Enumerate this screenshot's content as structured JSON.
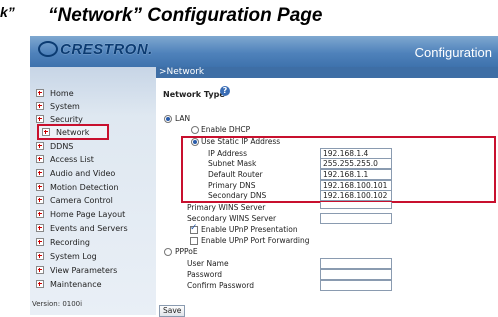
{
  "doc": {
    "title_fragment": "k”",
    "title": "“Network” Configuration Page"
  },
  "header": {
    "logo_text": "CRESTRON.",
    "right_text": "Configuration",
    "colors": {
      "gradient_top": "#7fa8d0",
      "gradient_bottom": "#3e72ad",
      "logo": "#0b3b72"
    }
  },
  "breadcrumb": ">Network",
  "sidebar": {
    "items": [
      {
        "label": "Home"
      },
      {
        "label": "System"
      },
      {
        "label": "Security"
      },
      {
        "label": "Network",
        "active": true
      },
      {
        "label": "DDNS"
      },
      {
        "label": "Access List"
      },
      {
        "label": "Audio and Video"
      },
      {
        "label": "Motion Detection"
      },
      {
        "label": "Camera Control"
      },
      {
        "label": "Home Page Layout"
      },
      {
        "label": "Events and Servers"
      },
      {
        "label": "Recording"
      },
      {
        "label": "System Log"
      },
      {
        "label": "View Parameters"
      },
      {
        "label": "Maintenance"
      }
    ],
    "version": "Version: 0100i",
    "highlight_color": "#c8102e"
  },
  "network": {
    "section_title": "Network Type",
    "help_icon": "help-icon",
    "lan_label": "LAN",
    "lan_selected": true,
    "dhcp_label": "Enable DHCP",
    "static_label": "Use Static IP Address",
    "static_selected": true,
    "fields": {
      "ip_address": {
        "label": "IP Address",
        "value": "192.168.1.4"
      },
      "subnet_mask": {
        "label": "Subnet Mask",
        "value": "255.255.255.0"
      },
      "default_router": {
        "label": "Default Router",
        "value": "192.168.1.1"
      },
      "primary_dns": {
        "label": "Primary DNS",
        "value": "192.168.100.101"
      },
      "secondary_dns": {
        "label": "Secondary DNS",
        "value": "192.168.100.102"
      },
      "primary_wins": {
        "label": "Primary WINS Server",
        "value": ""
      },
      "secondary_wins": {
        "label": "Secondary WINS Server",
        "value": ""
      }
    },
    "upnp_presentation_label": "Enable UPnP Presentation",
    "upnp_presentation_checked": true,
    "upnp_port_forwarding_label": "Enable UPnP Port Forwarding",
    "upnp_port_forwarding_checked": false,
    "pppoe_label": "PPPoE",
    "pppoe_fields": {
      "user_name": {
        "label": "User Name",
        "value": ""
      },
      "password": {
        "label": "Password",
        "value": ""
      },
      "confirm_password": {
        "label": "Confirm Password",
        "value": ""
      }
    },
    "save_label": "Save"
  }
}
